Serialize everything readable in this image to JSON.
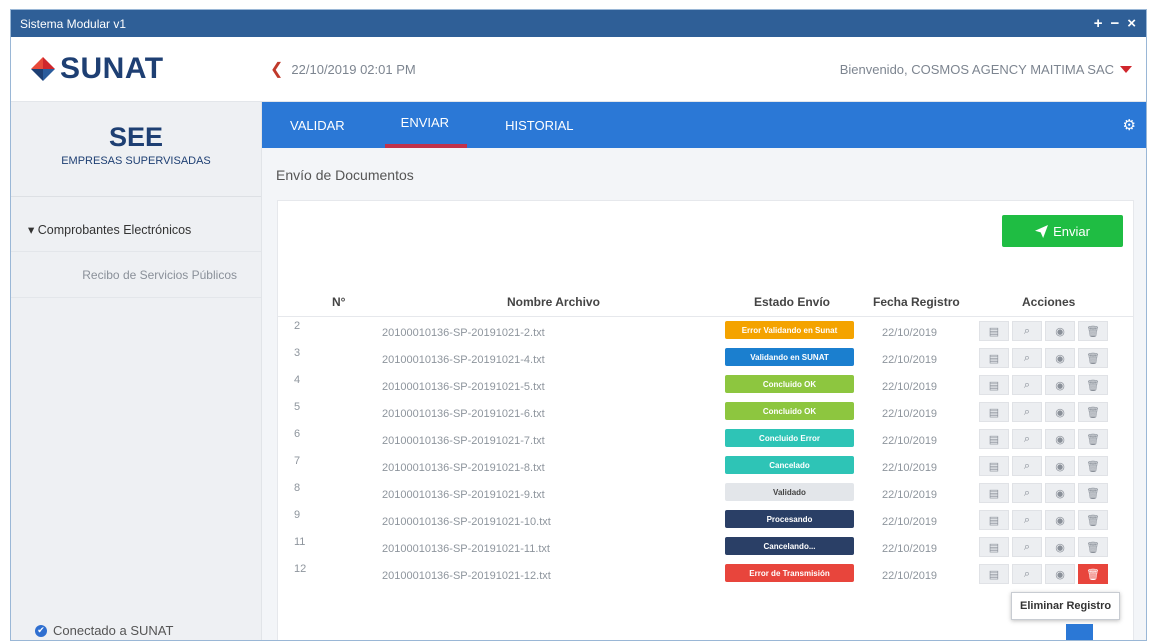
{
  "window": {
    "title": "Sistema Modular v1",
    "controls": [
      "+",
      "−",
      "×"
    ]
  },
  "header": {
    "logo_text": "SUNAT",
    "datetime": "22/10/2019 02:01 PM",
    "welcome": "Bienvenido, COSMOS AGENCY MAITIMA SAC"
  },
  "sidebar": {
    "title": "SEE",
    "subtitle": "EMPRESAS SUPERVISADAS",
    "menu_header": "▾ Comprobantes Electrónicos",
    "menu_item": "Recibo de Servicios Públicos",
    "status": "Conectado a SUNAT"
  },
  "tabs": [
    "VALIDAR",
    "ENVIAR",
    "HISTORIAL"
  ],
  "main": {
    "section_title": "Envío de Documentos",
    "send_label": "Enviar",
    "tooltip": "Eliminar Registro"
  },
  "table": {
    "headers": {
      "n": "N°",
      "file": "Nombre Archivo",
      "status": "Estado Envío",
      "date": "Fecha Registro",
      "actions": "Acciones"
    },
    "rows": [
      {
        "n": "2",
        "file": "20100010136-SP-20191021-2.txt",
        "status": "Error Validando en Sunat",
        "status_color": "#f4a300",
        "date": "22/10/2019"
      },
      {
        "n": "3",
        "file": "20100010136-SP-20191021-4.txt",
        "status": "Validando en SUNAT",
        "status_color": "#1b7fcf",
        "date": "22/10/2019"
      },
      {
        "n": "4",
        "file": "20100010136-SP-20191021-5.txt",
        "status": "Concluido OK",
        "status_color": "#8dc63f",
        "date": "22/10/2019"
      },
      {
        "n": "5",
        "file": "20100010136-SP-20191021-6.txt",
        "status": "Concluido OK",
        "status_color": "#8dc63f",
        "date": "22/10/2019"
      },
      {
        "n": "6",
        "file": "20100010136-SP-20191021-7.txt",
        "status": "Concluido Error",
        "status_color": "#2ec4b6",
        "date": "22/10/2019"
      },
      {
        "n": "7",
        "file": "20100010136-SP-20191021-8.txt",
        "status": "Cancelado",
        "status_color": "#2ec4b6",
        "date": "22/10/2019"
      },
      {
        "n": "8",
        "file": "20100010136-SP-20191021-9.txt",
        "status": "Validado",
        "status_color": "#e3e6ea",
        "status_text_color": "#444444",
        "date": "22/10/2019"
      },
      {
        "n": "9",
        "file": "20100010136-SP-20191021-10.txt",
        "status": "Procesando",
        "status_color": "#2a3f66",
        "date": "22/10/2019"
      },
      {
        "n": "11",
        "file": "20100010136-SP-20191021-11.txt",
        "status": "Cancelando...",
        "status_color": "#2a3f66",
        "date": "22/10/2019"
      },
      {
        "n": "12",
        "file": "20100010136-SP-20191021-12.txt",
        "status": "Error de Transmisión",
        "status_color": "#e8453c",
        "date": "22/10/2019"
      }
    ]
  },
  "icons": {
    "action_icons": [
      "list-icon",
      "search-icon",
      "target-icon",
      "trash-icon"
    ]
  }
}
